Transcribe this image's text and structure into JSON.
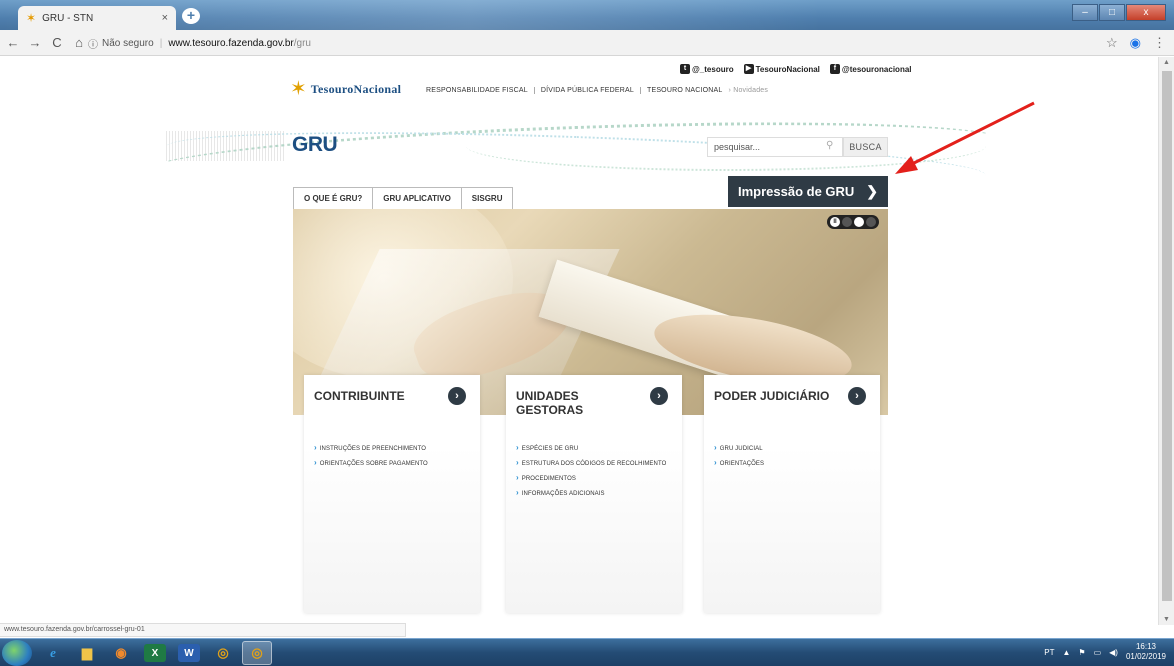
{
  "browser": {
    "tab_title": "GRU - STN",
    "tab_close": "×",
    "new_tab": "+",
    "nav": {
      "back": "←",
      "forward": "→",
      "reload": "C",
      "home": "⌂"
    },
    "security_label": "Não seguro",
    "url_host": "www.tesouro.fazenda.gov.br",
    "url_path": "/gru",
    "window_controls": {
      "minimize": "–",
      "maximize": "□",
      "close": "x"
    }
  },
  "header": {
    "logo_text": "TesouroNacional",
    "nav_items": [
      "RESPONSABILIDADE FISCAL",
      "DÍVIDA PÚBLICA FEDERAL",
      "TESOURO NACIONAL"
    ],
    "novidades": "Novidades",
    "social": [
      {
        "icon": "twitter-icon",
        "label": "@_tesouro"
      },
      {
        "icon": "youtube-icon",
        "label": "TesouroNacional"
      },
      {
        "icon": "facebook-icon",
        "label": "@tesouronacional"
      }
    ]
  },
  "page_title": "GRU",
  "search": {
    "placeholder": "pesquisar...",
    "button": "BUSCA"
  },
  "tabs": [
    "O QUE É GRU?",
    "GRU APLICATIVO",
    "SISGRU"
  ],
  "impressao_button": "Impressão de GRU",
  "cards": [
    {
      "title": "CONTRIBUINTE",
      "links": [
        "INSTRUÇÕES DE PREENCHIMENTO",
        "ORIENTAÇÕES SOBRE PAGAMENTO"
      ]
    },
    {
      "title": "UNIDADES GESTORAS",
      "links": [
        "ESPÉCIES DE GRU",
        "ESTRUTURA DOS CÓDIGOS DE RECOLHIMENTO",
        "PROCEDIMENTOS",
        "INFORMAÇÕES ADICIONAIS"
      ]
    },
    {
      "title": "PODER JUDICIÁRIO",
      "links": [
        "GRU JUDICIAL",
        "ORIENTAÇÕES"
      ]
    }
  ],
  "status_url": "www.tesouro.fazenda.gov.br/carrossel-gru-01",
  "taskbar": {
    "language": "PT",
    "time": "16:13",
    "date": "01/02/2019"
  },
  "colors": {
    "brand_blue": "#1d4f82",
    "dark_button": "#2f3b45",
    "link_arrow": "#2b8fd0",
    "annotation_arrow": "#e3201b"
  }
}
